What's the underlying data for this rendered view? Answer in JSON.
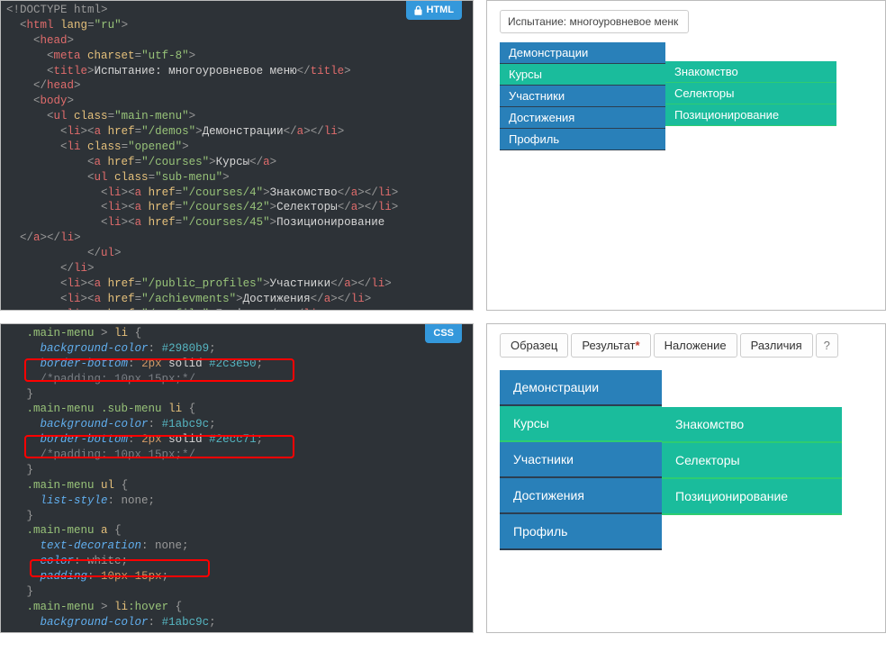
{
  "badges": {
    "html": "HTML",
    "css": "CSS"
  },
  "title_field": "Испытание: многоуровневое менк",
  "html_lines": {
    "l1": "<!DOCTYPE html>",
    "l2a": "<",
    "l2b": "html",
    "l2c": " lang",
    "l2d": "=",
    "l2e": "\"ru\"",
    "l2f": ">",
    "l3a": "<",
    "l3b": "head",
    "l3c": ">",
    "l4a": "<",
    "l4b": "meta",
    "l4c": " charset",
    "l4d": "=",
    "l4e": "\"utf-8\"",
    "l4f": ">",
    "l5a": "<",
    "l5b": "title",
    "l5c": ">",
    "l5d": "Испытание: многоуровневое меню",
    "l5e": "</",
    "l5f": "title",
    "l5g": ">",
    "l6a": "</",
    "l6b": "head",
    "l6c": ">",
    "l7a": "<",
    "l7b": "body",
    "l7c": ">",
    "l8a": "<",
    "l8b": "ul",
    "l8c": " class",
    "l8d": "=",
    "l8e": "\"main-menu\"",
    "l8f": ">",
    "l9a": "<",
    "l9b": "li",
    "l9c": "><",
    "l9d": "a",
    "l9e": " href",
    "l9f": "=",
    "l9g": "\"/demos\"",
    "l9h": ">",
    "l9i": "Демонстрации",
    "l9j": "</",
    "l9k": "a",
    "l9l": "></",
    "l9m": "li",
    "l9n": ">",
    "l10a": "<",
    "l10b": "li",
    "l10c": " class",
    "l10d": "=",
    "l10e": "\"opened\"",
    "l10f": ">",
    "l11a": "<",
    "l11b": "a",
    "l11c": " href",
    "l11d": "=",
    "l11e": "\"/courses\"",
    "l11f": ">",
    "l11g": "Курсы",
    "l11h": "</",
    "l11i": "a",
    "l11j": ">",
    "l12a": "<",
    "l12b": "ul",
    "l12c": " class",
    "l12d": "=",
    "l12e": "\"sub-menu\"",
    "l12f": ">",
    "l13a": "<",
    "l13b": "li",
    "l13c": "><",
    "l13d": "a",
    "l13e": " href",
    "l13f": "=",
    "l13g": "\"/courses/4\"",
    "l13h": ">",
    "l13i": "Знакомство",
    "l13j": "</",
    "l13k": "a",
    "l13l": "></",
    "l13m": "li",
    "l13n": ">",
    "l14a": "<",
    "l14b": "li",
    "l14c": "><",
    "l14d": "a",
    "l14e": " href",
    "l14f": "=",
    "l14g": "\"/courses/42\"",
    "l14h": ">",
    "l14i": "Селекторы",
    "l14j": "</",
    "l14k": "a",
    "l14l": "></",
    "l14m": "li",
    "l14n": ">",
    "l15a": "<",
    "l15b": "li",
    "l15c": "><",
    "l15d": "a",
    "l15e": " href",
    "l15f": "=",
    "l15g": "\"/courses/45\"",
    "l15h": ">",
    "l15i": "Позиционирование",
    "l16a": "</",
    "l16b": "a",
    "l16c": "></",
    "l16d": "li",
    "l16e": ">",
    "l17a": "</",
    "l17b": "ul",
    "l17c": ">",
    "l18a": "</",
    "l18b": "li",
    "l18c": ">",
    "l19a": "<",
    "l19b": "li",
    "l19c": "><",
    "l19d": "a",
    "l19e": " href",
    "l19f": "=",
    "l19g": "\"/public_profiles\"",
    "l19h": ">",
    "l19i": "Участники",
    "l19j": "</",
    "l19k": "a",
    "l19l": "></",
    "l19m": "li",
    "l19n": ">",
    "l20a": "<",
    "l20b": "li",
    "l20c": "><",
    "l20d": "a",
    "l20e": " href",
    "l20f": "=",
    "l20g": "\"/achievments\"",
    "l20h": ">",
    "l20i": "Достижения",
    "l20j": "</",
    "l20k": "a",
    "l20l": "></",
    "l20m": "li",
    "l20n": ">",
    "l21a": "<",
    "l21b": "li",
    "l21c": "><",
    "l21d": "a",
    "l21e": " href",
    "l21f": "=",
    "l21g": "\"/profile\"",
    "l21h": ">",
    "l21i": "Профиль",
    "l21j": "</",
    "l21k": "a",
    "l21l": "></",
    "l21m": "li",
    "l21n": ">"
  },
  "css_lines": {
    "c1a": ".main-menu",
    "c1b": " > ",
    "c1c": "li",
    "c1d": " {",
    "c2a": "background-color",
    "c2b": ": ",
    "c2c": "#2980b9",
    "c2d": ";",
    "c3a": "border-bottom",
    "c3b": ": ",
    "c3c": "2px",
    "c3d": " solid ",
    "c3e": "#2c3e50",
    "c3f": ";",
    "c4": "/*padding: 10px 15px;*/",
    "c5": "}",
    "c6a": ".main-menu",
    "c6b": " ",
    "c6c": ".sub-menu",
    "c6d": " ",
    "c6e": "li",
    "c6f": " {",
    "c7a": "background-color",
    "c7b": ": ",
    "c7c": "#1abc9c",
    "c7d": ";",
    "c8a": "border-bottom",
    "c8b": ": ",
    "c8c": "2px",
    "c8d": " solid ",
    "c8e": "#2ecc71",
    "c8f": ";",
    "c9": "/*padding: 10px 15px;*/",
    "c10": "}",
    "c11a": ".main-menu",
    "c11b": " ",
    "c11c": "ul",
    "c11d": " {",
    "c12a": "list-style",
    "c12b": ": none;",
    "c13": "}",
    "c14a": ".main-menu",
    "c14b": " ",
    "c14c": "a",
    "c14d": " {",
    "c15a": "text-decoration",
    "c15b": ": none;",
    "c16a": "color",
    "c16b": ": white;",
    "c17a": "padding",
    "c17b": ": ",
    "c17c": "10px",
    "c17d": " ",
    "c17e": "15px",
    "c17f": ";",
    "c18": "}",
    "c19a": ".main-menu",
    "c19b": " > ",
    "c19c": "li",
    "c19d": ":hover",
    "c19e": " {",
    "c20a": "background-color",
    "c20b": ": ",
    "c20c": "#1abc9c",
    "c20d": ";"
  },
  "menu": {
    "items": [
      "Демонстрации",
      "Курсы",
      "Участники",
      "Достижения",
      "Профиль"
    ],
    "sub": [
      "Знакомство",
      "Селекторы",
      "Позиционирование"
    ]
  },
  "tabs": {
    "t1": "Образец",
    "t2": "Результат",
    "mark": "*",
    "t3": "Наложение",
    "t4": "Различия",
    "help": "?"
  }
}
